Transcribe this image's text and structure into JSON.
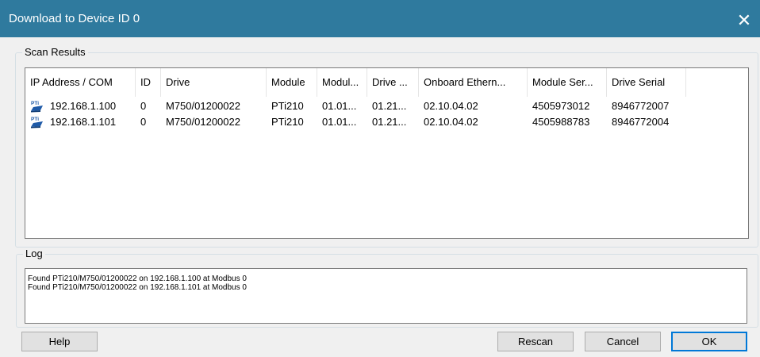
{
  "window": {
    "title": "Download to Device ID 0",
    "close_glyph": "✕"
  },
  "scan": {
    "group_label": "Scan Results",
    "columns": [
      "IP Address / COM",
      "ID",
      "Drive",
      "Module",
      "Modul...",
      "Drive ...",
      "Onboard Ethern...",
      "Module Ser...",
      "Drive Serial"
    ],
    "rows": [
      {
        "icon": "pti-device-icon",
        "cells": [
          "192.168.1.100",
          "0",
          "M750/01200022",
          "PTi210",
          "01.01...",
          "01.21...",
          "02.10.04.02",
          "4505973012",
          "8946772007"
        ]
      },
      {
        "icon": "pti-device-icon",
        "cells": [
          "192.168.1.101",
          "0",
          "M750/01200022",
          "PTi210",
          "01.01...",
          "01.21...",
          "02.10.04.02",
          "4505988783",
          "8946772004"
        ]
      }
    ]
  },
  "log": {
    "group_label": "Log",
    "lines": [
      "Found PTi210/M750/01200022 on 192.168.1.100 at Modbus 0",
      "Found PTi210/M750/01200022 on 192.168.1.101 at Modbus 0"
    ]
  },
  "buttons": {
    "help": "Help",
    "rescan": "Rescan",
    "cancel": "Cancel",
    "ok": "OK"
  },
  "colors": {
    "titlebar": "#2f7a9e",
    "default_button_border": "#0078d7",
    "icon_blue": "#1e5aa8"
  }
}
